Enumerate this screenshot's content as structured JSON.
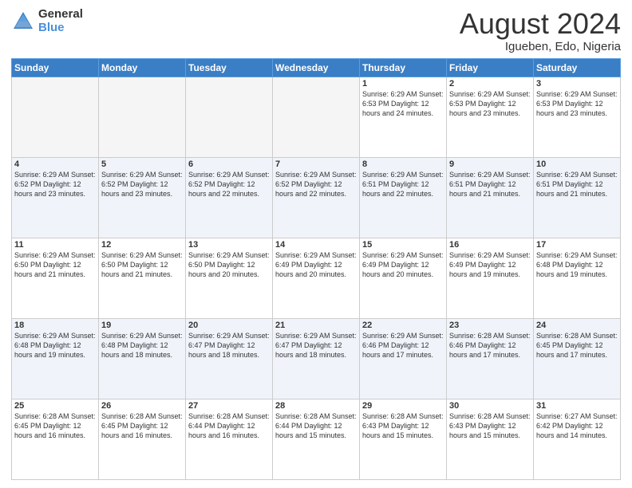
{
  "header": {
    "logo_general": "General",
    "logo_blue": "Blue",
    "title": "August 2024",
    "location": "Igueben, Edo, Nigeria"
  },
  "weekdays": [
    "Sunday",
    "Monday",
    "Tuesday",
    "Wednesday",
    "Thursday",
    "Friday",
    "Saturday"
  ],
  "weeks": [
    [
      {
        "day": "",
        "info": ""
      },
      {
        "day": "",
        "info": ""
      },
      {
        "day": "",
        "info": ""
      },
      {
        "day": "",
        "info": ""
      },
      {
        "day": "1",
        "info": "Sunrise: 6:29 AM\nSunset: 6:53 PM\nDaylight: 12 hours\nand 24 minutes."
      },
      {
        "day": "2",
        "info": "Sunrise: 6:29 AM\nSunset: 6:53 PM\nDaylight: 12 hours\nand 23 minutes."
      },
      {
        "day": "3",
        "info": "Sunrise: 6:29 AM\nSunset: 6:53 PM\nDaylight: 12 hours\nand 23 minutes."
      }
    ],
    [
      {
        "day": "4",
        "info": "Sunrise: 6:29 AM\nSunset: 6:52 PM\nDaylight: 12 hours\nand 23 minutes."
      },
      {
        "day": "5",
        "info": "Sunrise: 6:29 AM\nSunset: 6:52 PM\nDaylight: 12 hours\nand 23 minutes."
      },
      {
        "day": "6",
        "info": "Sunrise: 6:29 AM\nSunset: 6:52 PM\nDaylight: 12 hours\nand 22 minutes."
      },
      {
        "day": "7",
        "info": "Sunrise: 6:29 AM\nSunset: 6:52 PM\nDaylight: 12 hours\nand 22 minutes."
      },
      {
        "day": "8",
        "info": "Sunrise: 6:29 AM\nSunset: 6:51 PM\nDaylight: 12 hours\nand 22 minutes."
      },
      {
        "day": "9",
        "info": "Sunrise: 6:29 AM\nSunset: 6:51 PM\nDaylight: 12 hours\nand 21 minutes."
      },
      {
        "day": "10",
        "info": "Sunrise: 6:29 AM\nSunset: 6:51 PM\nDaylight: 12 hours\nand 21 minutes."
      }
    ],
    [
      {
        "day": "11",
        "info": "Sunrise: 6:29 AM\nSunset: 6:50 PM\nDaylight: 12 hours\nand 21 minutes."
      },
      {
        "day": "12",
        "info": "Sunrise: 6:29 AM\nSunset: 6:50 PM\nDaylight: 12 hours\nand 21 minutes."
      },
      {
        "day": "13",
        "info": "Sunrise: 6:29 AM\nSunset: 6:50 PM\nDaylight: 12 hours\nand 20 minutes."
      },
      {
        "day": "14",
        "info": "Sunrise: 6:29 AM\nSunset: 6:49 PM\nDaylight: 12 hours\nand 20 minutes."
      },
      {
        "day": "15",
        "info": "Sunrise: 6:29 AM\nSunset: 6:49 PM\nDaylight: 12 hours\nand 20 minutes."
      },
      {
        "day": "16",
        "info": "Sunrise: 6:29 AM\nSunset: 6:49 PM\nDaylight: 12 hours\nand 19 minutes."
      },
      {
        "day": "17",
        "info": "Sunrise: 6:29 AM\nSunset: 6:48 PM\nDaylight: 12 hours\nand 19 minutes."
      }
    ],
    [
      {
        "day": "18",
        "info": "Sunrise: 6:29 AM\nSunset: 6:48 PM\nDaylight: 12 hours\nand 19 minutes."
      },
      {
        "day": "19",
        "info": "Sunrise: 6:29 AM\nSunset: 6:48 PM\nDaylight: 12 hours\nand 18 minutes."
      },
      {
        "day": "20",
        "info": "Sunrise: 6:29 AM\nSunset: 6:47 PM\nDaylight: 12 hours\nand 18 minutes."
      },
      {
        "day": "21",
        "info": "Sunrise: 6:29 AM\nSunset: 6:47 PM\nDaylight: 12 hours\nand 18 minutes."
      },
      {
        "day": "22",
        "info": "Sunrise: 6:29 AM\nSunset: 6:46 PM\nDaylight: 12 hours\nand 17 minutes."
      },
      {
        "day": "23",
        "info": "Sunrise: 6:28 AM\nSunset: 6:46 PM\nDaylight: 12 hours\nand 17 minutes."
      },
      {
        "day": "24",
        "info": "Sunrise: 6:28 AM\nSunset: 6:45 PM\nDaylight: 12 hours\nand 17 minutes."
      }
    ],
    [
      {
        "day": "25",
        "info": "Sunrise: 6:28 AM\nSunset: 6:45 PM\nDaylight: 12 hours\nand 16 minutes."
      },
      {
        "day": "26",
        "info": "Sunrise: 6:28 AM\nSunset: 6:45 PM\nDaylight: 12 hours\nand 16 minutes."
      },
      {
        "day": "27",
        "info": "Sunrise: 6:28 AM\nSunset: 6:44 PM\nDaylight: 12 hours\nand 16 minutes."
      },
      {
        "day": "28",
        "info": "Sunrise: 6:28 AM\nSunset: 6:44 PM\nDaylight: 12 hours\nand 15 minutes."
      },
      {
        "day": "29",
        "info": "Sunrise: 6:28 AM\nSunset: 6:43 PM\nDaylight: 12 hours\nand 15 minutes."
      },
      {
        "day": "30",
        "info": "Sunrise: 6:28 AM\nSunset: 6:43 PM\nDaylight: 12 hours\nand 15 minutes."
      },
      {
        "day": "31",
        "info": "Sunrise: 6:27 AM\nSunset: 6:42 PM\nDaylight: 12 hours\nand 14 minutes."
      }
    ]
  ]
}
